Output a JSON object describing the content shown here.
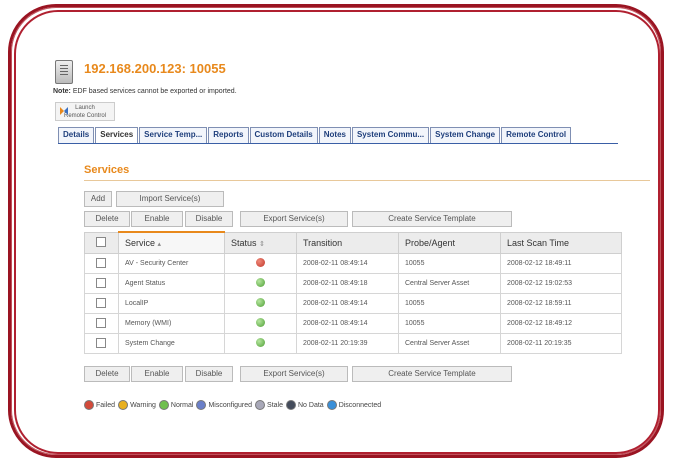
{
  "device": {
    "title": "192.168.200.123: 10055"
  },
  "note": {
    "label": "Note:",
    "text": "EDF based services cannot be exported or imported."
  },
  "launch": {
    "line1": "Launch",
    "line2": "Remote Control"
  },
  "tabs": [
    "Details",
    "Services",
    "Service Temp...",
    "Reports",
    "Custom Details",
    "Notes",
    "System Commu...",
    "System Change",
    "Remote Control"
  ],
  "active_tab": "Services",
  "section_title": "Services",
  "toolbar_top": {
    "add": "Add",
    "import": "Import Service(s)"
  },
  "toolbar": {
    "delete": "Delete",
    "enable": "Enable",
    "disable": "Disable",
    "export": "Export Service(s)",
    "create_template": "Create Service Template"
  },
  "table": {
    "headers": {
      "service": "Service",
      "status": "Status",
      "transition": "Transition",
      "probe": "Probe/Agent",
      "last_scan": "Last Scan Time"
    },
    "sort_service_glyph": "▴",
    "sort_status_glyph": "⇕",
    "rows": [
      {
        "service": "AV - Security Center",
        "status": "Failed",
        "transition": "2008-02-11 08:49:14",
        "probe": "10055",
        "last_scan": "2008-02-12 18:49:11"
      },
      {
        "service": "Agent Status",
        "status": "Normal",
        "transition": "2008-02-11 08:49:18",
        "probe": "Central Server Asset",
        "last_scan": "2008-02-12 19:02:53"
      },
      {
        "service": "LocalIP",
        "status": "Normal",
        "transition": "2008-02-11 08:49:14",
        "probe": "10055",
        "last_scan": "2008-02-12 18:59:11"
      },
      {
        "service": "Memory (WMI)",
        "status": "Normal",
        "transition": "2008-02-11 08:49:14",
        "probe": "10055",
        "last_scan": "2008-02-12 18:49:12"
      },
      {
        "service": "System Change",
        "status": "Normal",
        "transition": "2008-02-11 20:19:39",
        "probe": "Central Server Asset",
        "last_scan": "2008-02-11 20:19:35"
      }
    ]
  },
  "legend": [
    {
      "label": "Failed",
      "color": "#d24a3a"
    },
    {
      "label": "Warning",
      "color": "#e8b020"
    },
    {
      "label": "Normal",
      "color": "#6fbf4f"
    },
    {
      "label": "Misconfigured",
      "color": "#6a7fc8"
    },
    {
      "label": "Stale",
      "color": "#a8a8b8"
    },
    {
      "label": "No Data",
      "color": "#444c5c"
    },
    {
      "label": "Disconnected",
      "color": "#3a8fd8"
    }
  ],
  "status_colors": {
    "Failed": "#d24a3a",
    "Normal": "#6fbf4f"
  }
}
